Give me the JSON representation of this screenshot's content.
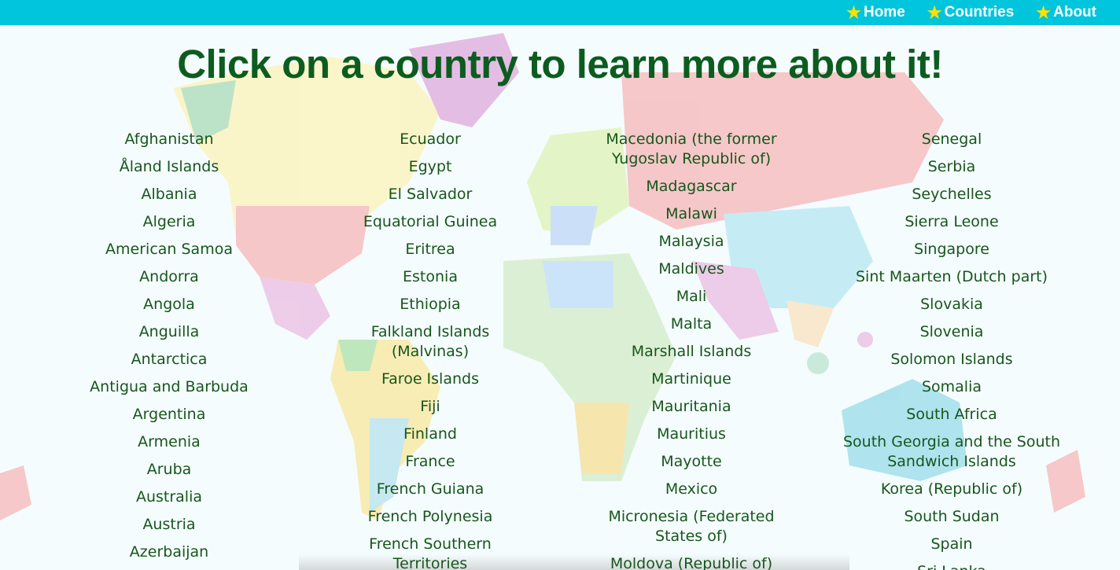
{
  "nav": [
    {
      "label": "Home",
      "icon": "star-icon"
    },
    {
      "label": "Countries",
      "icon": "star-icon"
    },
    {
      "label": "About",
      "icon": "star-icon"
    }
  ],
  "heading": "Click on a country to learn more about it!",
  "colors": {
    "topbar": "#00c5dc",
    "heading": "#0c5c1f",
    "link": "#17561c",
    "star": "#ffe100",
    "background": "#f5fcfd"
  },
  "columns": [
    [
      "Afghanistan",
      "Åland Islands",
      "Albania",
      "Algeria",
      "American Samoa",
      "Andorra",
      "Angola",
      "Anguilla",
      "Antarctica",
      "Antigua and Barbuda",
      "Argentina",
      "Armenia",
      "Aruba",
      "Australia",
      "Austria",
      "Azerbaijan"
    ],
    [
      "Ecuador",
      "Egypt",
      "El Salvador",
      "Equatorial Guinea",
      "Eritrea",
      "Estonia",
      "Ethiopia",
      "Falkland Islands (Malvinas)",
      "Faroe Islands",
      "Fiji",
      "Finland",
      "France",
      "French Guiana",
      "French Polynesia",
      "French Southern Territories"
    ],
    [
      "Macedonia (the former Yugoslav Republic of)",
      "Madagascar",
      "Malawi",
      "Malaysia",
      "Maldives",
      "Mali",
      "Malta",
      "Marshall Islands",
      "Martinique",
      "Mauritania",
      "Mauritius",
      "Mayotte",
      "Mexico",
      "Micronesia (Federated States of)",
      "Moldova (Republic of)"
    ],
    [
      "Senegal",
      "Serbia",
      "Seychelles",
      "Sierra Leone",
      "Singapore",
      "Sint Maarten (Dutch part)",
      "Slovakia",
      "Slovenia",
      "Solomon Islands",
      "Somalia",
      "South Africa",
      "South Georgia and the South Sandwich Islands",
      "Korea (Republic of)",
      "South Sudan",
      "Spain",
      "Sri Lanka"
    ]
  ]
}
